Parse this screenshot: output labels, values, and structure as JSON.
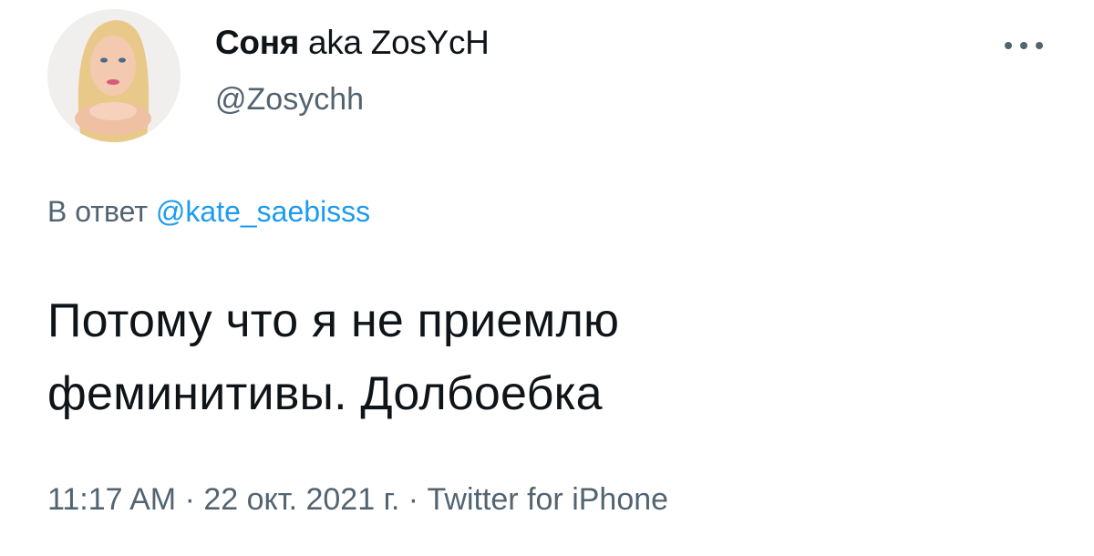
{
  "author": {
    "display_name": "Соня",
    "display_name_suffix": "aka ZosYcH",
    "handle": "@Zosychh"
  },
  "reply": {
    "prefix": "В ответ",
    "mention": "@kate_saebisss"
  },
  "tweet": {
    "line1": "Потому что я не приемлю",
    "line2": "феминитивы. Долбоебка"
  },
  "meta": {
    "time": "11:17 AM",
    "separator1": " · ",
    "date": "22 окт. 2021 г.",
    "separator2": " · ",
    "source": "Twitter for iPhone"
  },
  "icons": {
    "more": "more-horizontal-icon",
    "avatar": "profile-avatar"
  },
  "colors": {
    "text": "#0f1419",
    "secondary": "#536471",
    "link": "#1d9bf0"
  }
}
